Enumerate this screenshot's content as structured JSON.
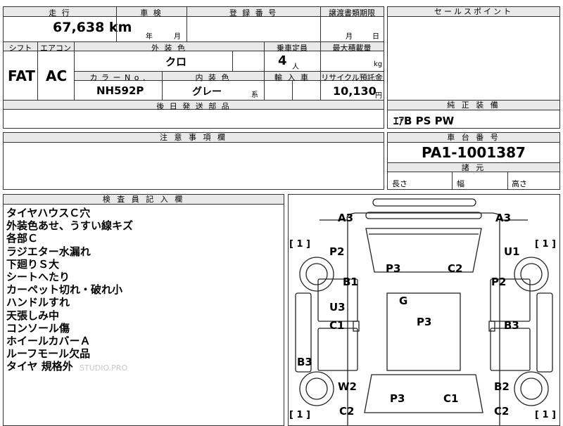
{
  "top_left": {
    "mileage_header": "走 行",
    "mileage_value": "67,638 km",
    "inspection_header": "車 検",
    "inspection_year": "年",
    "inspection_month": "月",
    "registration_header": "登 録 番 号",
    "transfer_header": "譲渡書類期限",
    "transfer_month": "月",
    "transfer_day": "日",
    "shift_header": "シフト",
    "shift_value": "FAT",
    "ac_header": "エアコン",
    "ac_value": "AC",
    "exterior_header": "外 装 色",
    "exterior_value": "クロ",
    "capacity_header": "乗車定員",
    "capacity_value": "4",
    "capacity_unit": "人",
    "max_load_header": "最大積載量",
    "max_load_unit": "kg",
    "color_no_header": "カ ラ ー N o .",
    "color_no_value": "NH592P",
    "interior_header": "内 装 色",
    "interior_value": "グレー",
    "interior_suffix": "系",
    "import_header": "輸 入 車",
    "recycle_header": "リサイクル預託金",
    "recycle_value": "10,130",
    "recycle_unit": "円",
    "later_parts_header": "後 日 発 送 部 品"
  },
  "sales_point": {
    "header": "セールスポイント"
  },
  "genuine_equipment": {
    "header": "純 正 装 備",
    "value": "ｴｱB PS PW"
  },
  "caution": {
    "header": "注 意 事 項 欄"
  },
  "chassis": {
    "header": "車 台 番 号",
    "value": "PA1-1001387",
    "dimensions_header": "諸 元",
    "length_label": "長さ",
    "width_label": "幅",
    "height_label": "高さ"
  },
  "inspector": {
    "header": "検 査 員 記 入 欄",
    "notes": [
      "タイヤハウスＣ穴",
      "外装色あせ、うすい線キズ",
      "各部Ｃ",
      "ラジエター水漏れ",
      "下廻りＳ大",
      "シートへたり",
      "カーペット切れ・破れ小",
      "ハンドルすれ",
      "天張しみ中",
      "コンソール傷",
      "ホイールカバーＡ",
      "ルーフモール欠品",
      "タイヤ 規格外"
    ],
    "watermark": "STUDIO.PRO"
  },
  "diagram": {
    "marks": {
      "a3_left": "A3",
      "a3_right": "A3",
      "p2_left": "P2",
      "u1_right": "U1",
      "p3_top": "P3",
      "c2_top": "C2",
      "b1_left": "B1",
      "p2_right": "P2",
      "g_roof": "G",
      "u3_left": "U3",
      "p3_roof": "P3",
      "c1_left": "C1",
      "b3_right": "B3",
      "b3_left": "B3",
      "w2_left": "W2",
      "b2_right": "B2",
      "p3_bottom": "P3",
      "c1_bottom": "C1",
      "c2_bottom_left": "C2",
      "c2_bottom_right": "C2"
    },
    "brackets": {
      "front_left": "[ 1 ]",
      "front_right": "[ 1 ]",
      "rear_left": "[ 1 ]",
      "rear_right": "[ 1 ]"
    }
  }
}
